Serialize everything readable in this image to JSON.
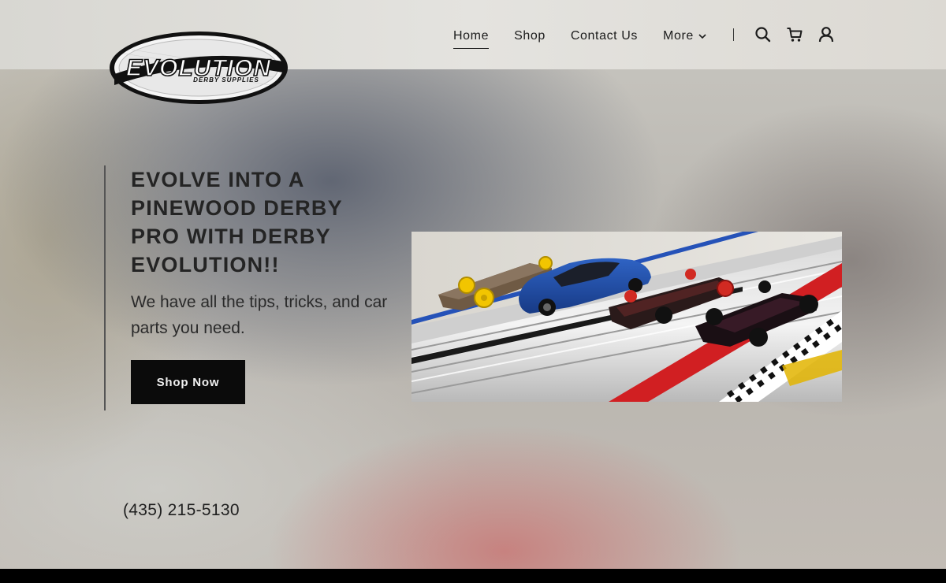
{
  "brand": {
    "logo_text": "EVOLUTION",
    "logo_subtext": "DERBY SUPPLIES"
  },
  "nav": {
    "items": [
      {
        "label": "Home",
        "active": true
      },
      {
        "label": "Shop",
        "active": false
      },
      {
        "label": "Contact Us",
        "active": false
      },
      {
        "label": "More",
        "active": false,
        "has_dropdown": true
      }
    ],
    "icons": [
      "search-icon",
      "cart-icon",
      "account-icon"
    ]
  },
  "hero": {
    "headline": "EVOLVE INTO A PINEWOOD DERBY PRO WITH DERBY EVOLUTION!!",
    "subtext": "We have all the tips, tricks, and car parts you need.",
    "cta_label": "Shop Now",
    "image_alt": "Pinewood derby cars on aluminum race track"
  },
  "contact": {
    "phone": "(435) 215-5130"
  },
  "colors": {
    "accent_dark": "#0b0b0b",
    "header_bg": "#e0dfdb"
  }
}
